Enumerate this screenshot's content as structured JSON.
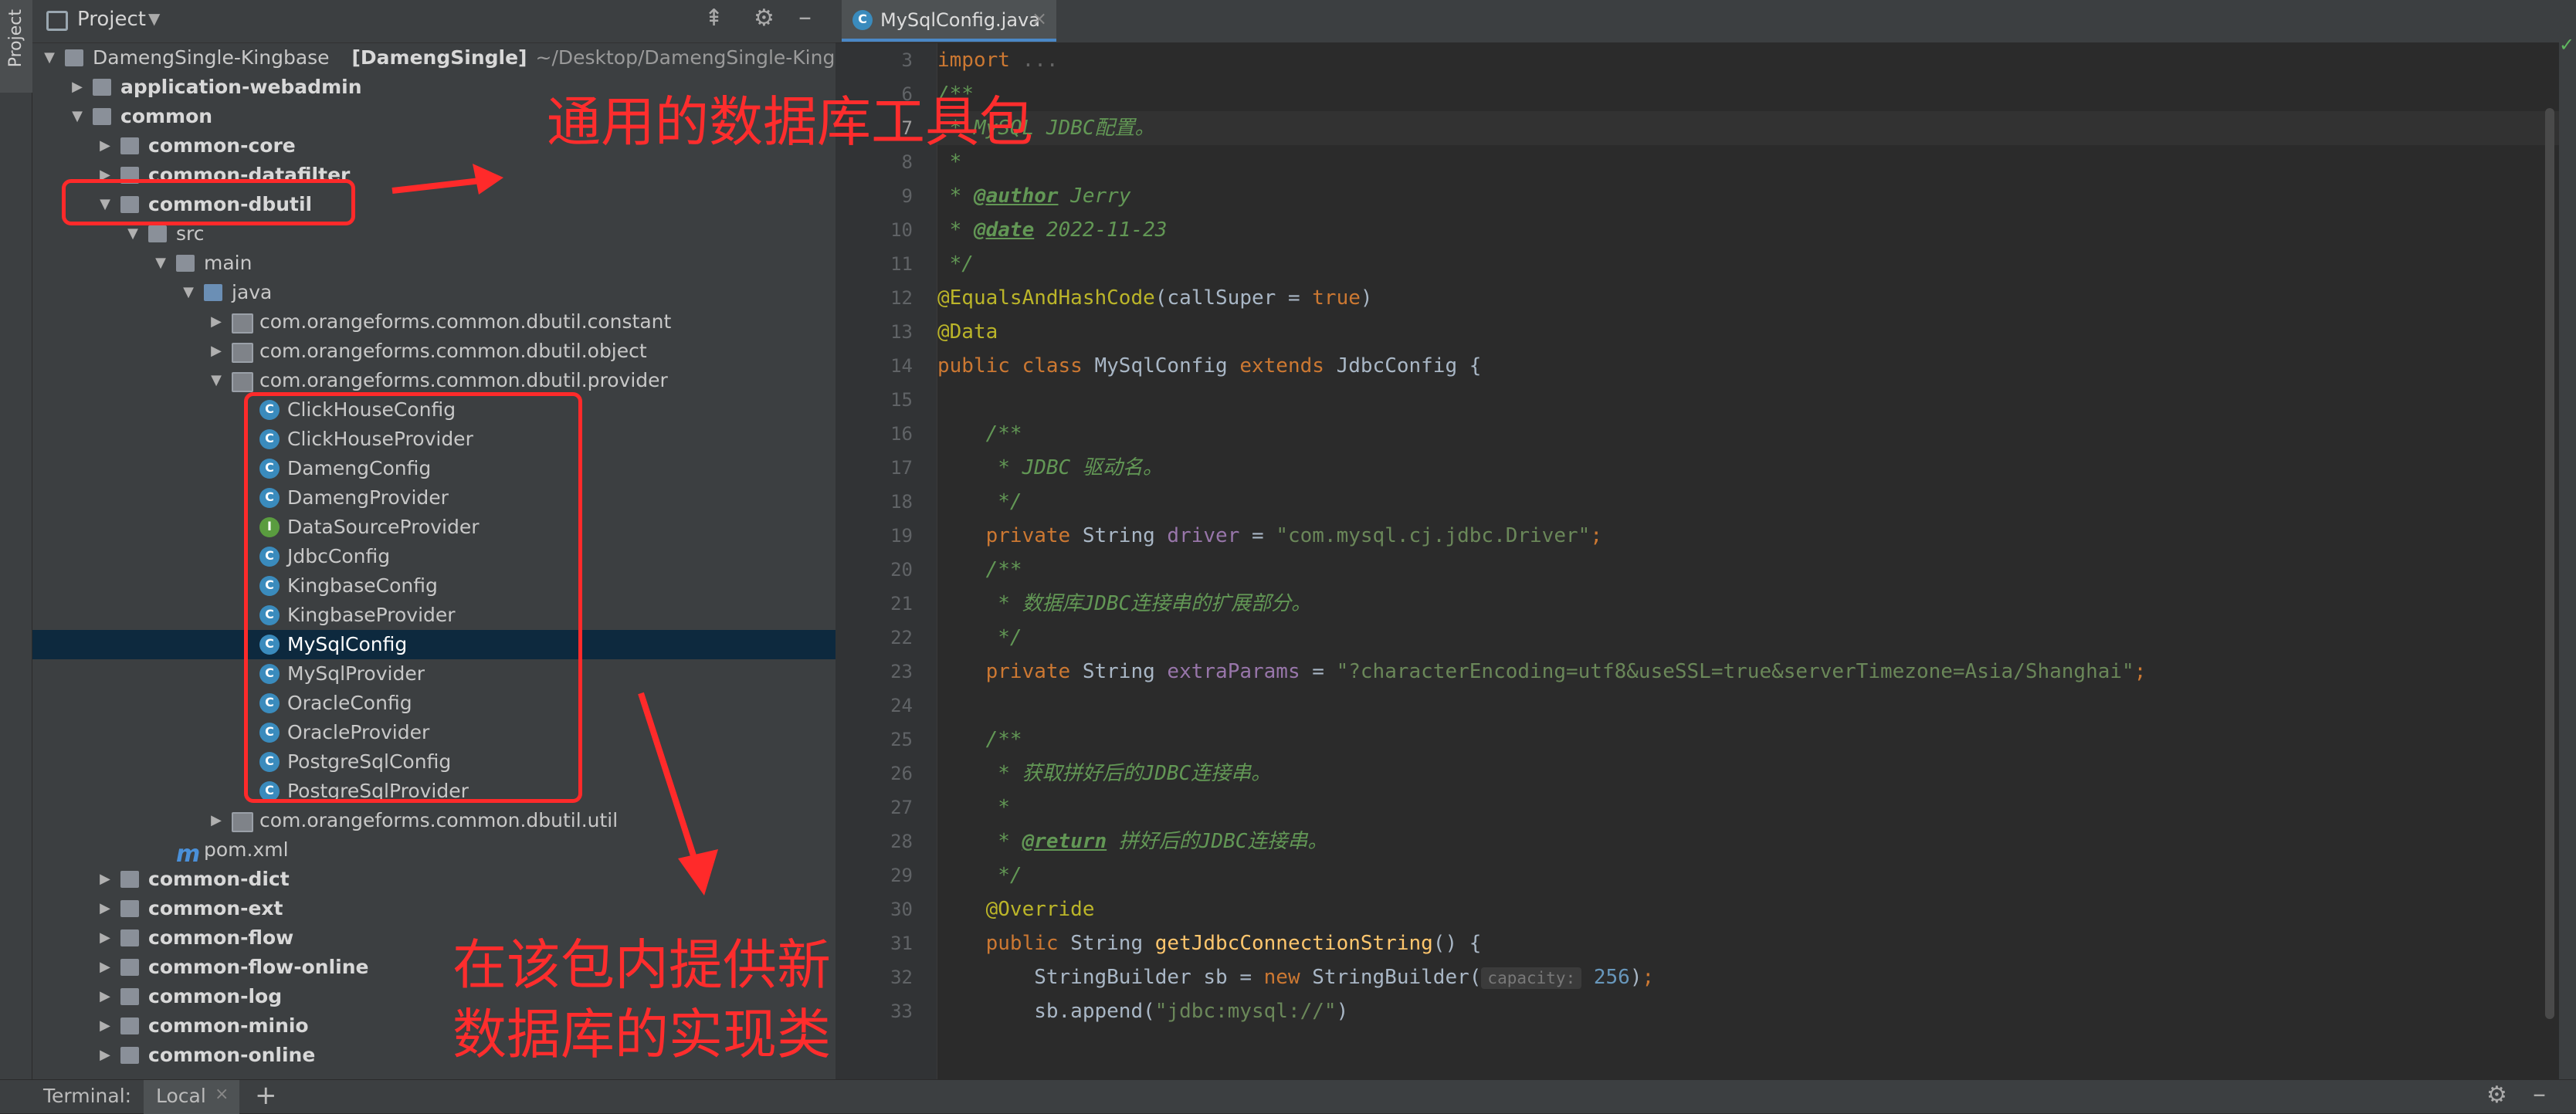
{
  "project_panel": {
    "title": "Project",
    "stripe_label": "Project",
    "tree": [
      {
        "label": "DamengSingle-Kingbase",
        "suffix": "[DamengSingle]",
        "path": "~/Desktop/DamengSingle-Kingb",
        "depth": 0,
        "arrow": "down",
        "icon": "module",
        "bold": false
      },
      {
        "label": "application-webadmin",
        "depth": 1,
        "arrow": "right",
        "icon": "folder",
        "bold": true
      },
      {
        "label": "common",
        "depth": 1,
        "arrow": "down",
        "icon": "folder",
        "bold": true
      },
      {
        "label": "common-core",
        "depth": 2,
        "arrow": "right",
        "icon": "folder",
        "bold": true
      },
      {
        "label": "common-datafilter",
        "depth": 2,
        "arrow": "right",
        "icon": "folder",
        "bold": true
      },
      {
        "label": "common-dbutil",
        "depth": 2,
        "arrow": "down",
        "icon": "folder",
        "bold": true
      },
      {
        "label": "src",
        "depth": 3,
        "arrow": "down",
        "icon": "folder",
        "bold": false
      },
      {
        "label": "main",
        "depth": 4,
        "arrow": "down",
        "icon": "folder",
        "bold": false
      },
      {
        "label": "java",
        "depth": 5,
        "arrow": "down",
        "icon": "folder-blue",
        "bold": false
      },
      {
        "label": "com.orangeforms.common.dbutil.constant",
        "depth": 6,
        "arrow": "right",
        "icon": "package",
        "bold": false
      },
      {
        "label": "com.orangeforms.common.dbutil.object",
        "depth": 6,
        "arrow": "right",
        "icon": "package",
        "bold": false
      },
      {
        "label": "com.orangeforms.common.dbutil.provider",
        "depth": 6,
        "arrow": "down",
        "icon": "package",
        "bold": false
      },
      {
        "label": "ClickHouseConfig",
        "depth": 7,
        "arrow": "",
        "icon": "class",
        "bold": false
      },
      {
        "label": "ClickHouseProvider",
        "depth": 7,
        "arrow": "",
        "icon": "class",
        "bold": false
      },
      {
        "label": "DamengConfig",
        "depth": 7,
        "arrow": "",
        "icon": "class",
        "bold": false
      },
      {
        "label": "DamengProvider",
        "depth": 7,
        "arrow": "",
        "icon": "class",
        "bold": false
      },
      {
        "label": "DataSourceProvider",
        "depth": 7,
        "arrow": "",
        "icon": "interface",
        "bold": false
      },
      {
        "label": "JdbcConfig",
        "depth": 7,
        "arrow": "",
        "icon": "class",
        "bold": false
      },
      {
        "label": "KingbaseConfig",
        "depth": 7,
        "arrow": "",
        "icon": "class",
        "bold": false
      },
      {
        "label": "KingbaseProvider",
        "depth": 7,
        "arrow": "",
        "icon": "class",
        "bold": false
      },
      {
        "label": "MySqlConfig",
        "depth": 7,
        "arrow": "",
        "icon": "class",
        "bold": false,
        "selected": true
      },
      {
        "label": "MySqlProvider",
        "depth": 7,
        "arrow": "",
        "icon": "class",
        "bold": false
      },
      {
        "label": "OracleConfig",
        "depth": 7,
        "arrow": "",
        "icon": "class",
        "bold": false
      },
      {
        "label": "OracleProvider",
        "depth": 7,
        "arrow": "",
        "icon": "class",
        "bold": false
      },
      {
        "label": "PostgreSqlConfig",
        "depth": 7,
        "arrow": "",
        "icon": "class",
        "bold": false
      },
      {
        "label": "PostgreSqlProvider",
        "depth": 7,
        "arrow": "",
        "icon": "class",
        "bold": false
      },
      {
        "label": "com.orangeforms.common.dbutil.util",
        "depth": 6,
        "arrow": "right",
        "icon": "package",
        "bold": false
      },
      {
        "label": "pom.xml",
        "depth": 4,
        "arrow": "",
        "icon": "maven",
        "bold": false
      },
      {
        "label": "common-dict",
        "depth": 2,
        "arrow": "right",
        "icon": "folder",
        "bold": true
      },
      {
        "label": "common-ext",
        "depth": 2,
        "arrow": "right",
        "icon": "folder",
        "bold": true
      },
      {
        "label": "common-flow",
        "depth": 2,
        "arrow": "right",
        "icon": "folder",
        "bold": true
      },
      {
        "label": "common-flow-online",
        "depth": 2,
        "arrow": "right",
        "icon": "folder",
        "bold": true
      },
      {
        "label": "common-log",
        "depth": 2,
        "arrow": "right",
        "icon": "folder",
        "bold": true
      },
      {
        "label": "common-minio",
        "depth": 2,
        "arrow": "right",
        "icon": "folder",
        "bold": true
      },
      {
        "label": "common-online",
        "depth": 2,
        "arrow": "right",
        "icon": "folder",
        "bold": true
      }
    ]
  },
  "editor": {
    "tab_label": "MySqlConfig.java",
    "lines": [
      {
        "n": "3",
        "tokens": [
          [
            "kw",
            "import "
          ],
          [
            "fold",
            "..."
          ]
        ]
      },
      {
        "n": "6",
        "tokens": [
          [
            "doc",
            "/**"
          ]
        ]
      },
      {
        "n": "7",
        "tokens": [
          [
            "doc",
            " * MySQL JDBC配置。"
          ]
        ],
        "current": true
      },
      {
        "n": "8",
        "tokens": [
          [
            "doc",
            " *"
          ]
        ]
      },
      {
        "n": "9",
        "tokens": [
          [
            "doc",
            " * "
          ],
          [
            "doctag",
            "@author"
          ],
          [
            "doc",
            " Jerry"
          ]
        ]
      },
      {
        "n": "10",
        "tokens": [
          [
            "doc",
            " * "
          ],
          [
            "doctag",
            "@date"
          ],
          [
            "doc",
            " 2022-11-23"
          ]
        ]
      },
      {
        "n": "11",
        "tokens": [
          [
            "doc",
            " */"
          ]
        ]
      },
      {
        "n": "12",
        "tokens": [
          [
            "ann",
            "@EqualsAndHashCode"
          ],
          [
            "txt",
            "(callSuper = "
          ],
          [
            "kw",
            "true"
          ],
          [
            "txt",
            ")"
          ]
        ]
      },
      {
        "n": "13",
        "tokens": [
          [
            "ann",
            "@Data"
          ]
        ]
      },
      {
        "n": "14",
        "tokens": [
          [
            "kw",
            "public class "
          ],
          [
            "txt",
            "MySqlConfig "
          ],
          [
            "kw",
            "extends "
          ],
          [
            "txt",
            "JdbcConfig {"
          ]
        ]
      },
      {
        "n": "15",
        "tokens": []
      },
      {
        "n": "16",
        "tokens": [
          [
            "doc",
            "    /**"
          ]
        ]
      },
      {
        "n": "17",
        "tokens": [
          [
            "doc",
            "     * JDBC 驱动名。"
          ]
        ]
      },
      {
        "n": "18",
        "tokens": [
          [
            "doc",
            "     */"
          ]
        ]
      },
      {
        "n": "19",
        "tokens": [
          [
            "kw",
            "    private "
          ],
          [
            "txt",
            "String "
          ],
          [
            "field",
            "driver"
          ],
          [
            "txt",
            " = "
          ],
          [
            "str",
            "\"com.mysql.cj.jdbc.Driver\""
          ],
          [
            "kw",
            ";"
          ]
        ]
      },
      {
        "n": "20",
        "tokens": [
          [
            "doc",
            "    /**"
          ]
        ]
      },
      {
        "n": "21",
        "tokens": [
          [
            "doc",
            "     * 数据库JDBC连接串的扩展部分。"
          ]
        ]
      },
      {
        "n": "22",
        "tokens": [
          [
            "doc",
            "     */"
          ]
        ]
      },
      {
        "n": "23",
        "tokens": [
          [
            "kw",
            "    private "
          ],
          [
            "txt",
            "String "
          ],
          [
            "field",
            "extraParams"
          ],
          [
            "txt",
            " = "
          ],
          [
            "str",
            "\"?characterEncoding=utf8&useSSL=true&serverTimezone=Asia/Shanghai\""
          ],
          [
            "kw",
            ";"
          ]
        ]
      },
      {
        "n": "24",
        "tokens": []
      },
      {
        "n": "25",
        "tokens": [
          [
            "doc",
            "    /**"
          ]
        ]
      },
      {
        "n": "26",
        "tokens": [
          [
            "doc",
            "     * 获取拼好后的JDBC连接串。"
          ]
        ]
      },
      {
        "n": "27",
        "tokens": [
          [
            "doc",
            "     *"
          ]
        ]
      },
      {
        "n": "28",
        "tokens": [
          [
            "doc",
            "     * "
          ],
          [
            "doctag",
            "@return"
          ],
          [
            "doc",
            " 拼好后的JDBC连接串。"
          ]
        ]
      },
      {
        "n": "29",
        "tokens": [
          [
            "doc",
            "     */"
          ]
        ]
      },
      {
        "n": "30",
        "tokens": [
          [
            "ann",
            "    @Override"
          ]
        ]
      },
      {
        "n": "31",
        "tokens": [
          [
            "kw",
            "    public "
          ],
          [
            "txt",
            "String "
          ],
          [
            "meth",
            "getJdbcConnectionString"
          ],
          [
            "txt",
            "() {"
          ]
        ]
      },
      {
        "n": "32",
        "tokens": [
          [
            "txt",
            "        StringBuilder sb = "
          ],
          [
            "kw",
            "new "
          ],
          [
            "txt",
            "StringBuilder("
          ],
          [
            "hint",
            "capacity:"
          ],
          [
            "num",
            " 256"
          ],
          [
            "txt",
            ")"
          ],
          [
            "kw",
            ";"
          ]
        ]
      },
      {
        "n": "33",
        "tokens": [
          [
            "txt",
            "        sb.append("
          ],
          [
            "str",
            "\"jdbc:mysql://\""
          ],
          [
            "txt",
            ")"
          ]
        ]
      }
    ]
  },
  "bottom_bar": {
    "terminal_label": "Terminal:",
    "local_tab": "Local",
    "add_label": "+"
  },
  "annotations": {
    "top_text": "通用的数据库工具包",
    "bottom_text_line1": "在该包内提供新",
    "bottom_text_line2": "数据库的实现类"
  }
}
